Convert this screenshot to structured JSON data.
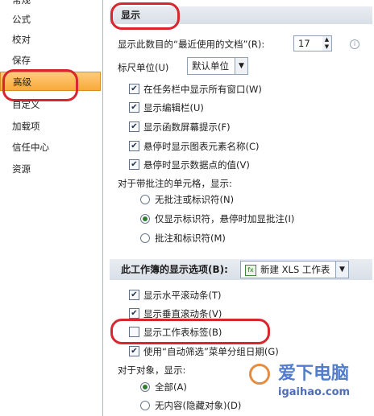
{
  "nav": {
    "items": [
      {
        "label": "常规"
      },
      {
        "label": "公式"
      },
      {
        "label": "校对"
      },
      {
        "label": "保存"
      },
      {
        "label": "高级"
      },
      {
        "label": "自定义"
      },
      {
        "label": "加载项"
      },
      {
        "label": "信任中心"
      },
      {
        "label": "资源"
      }
    ],
    "selected_index": 4
  },
  "display": {
    "header": "显示",
    "recent_docs_label": "显示此数目的“最近使用的文档”(R):",
    "recent_docs_value": "17",
    "ruler_label": "标尺单位(U)",
    "ruler_value": "默认单位",
    "checkboxes": [
      {
        "label": "在任务栏中显示所有窗口(W)",
        "checked": true
      },
      {
        "label": "显示编辑栏(U)",
        "checked": true
      },
      {
        "label": "显示函数屏幕提示(F)",
        "checked": true
      },
      {
        "label": "悬停时显示图表元素名称(C)",
        "checked": true
      },
      {
        "label": "悬停时显示数据点的值(V)",
        "checked": true
      }
    ],
    "comments_label": "对于带批注的单元格，显示:",
    "comment_options": [
      {
        "label": "无批注或标识符(N)",
        "selected": false
      },
      {
        "label": "仅显示标识符，悬停时加显批注(I)",
        "selected": true
      },
      {
        "label": "批注和标识符(M)",
        "selected": false
      }
    ]
  },
  "workbook": {
    "header": "此工作簿的显示选项(B):",
    "select_value": "新建 XLS 工作表",
    "icon": "excel-workbook-icon",
    "checkboxes": [
      {
        "label": "显示水平滚动条(T)",
        "checked": true
      },
      {
        "label": "显示垂直滚动条(V)",
        "checked": true
      },
      {
        "label": "显示工作表标签(B)",
        "checked": false
      },
      {
        "label": "使用“自动筛选”菜单分组日期(G)",
        "checked": true
      }
    ],
    "objects_label": "对于对象，显示:",
    "object_options": [
      {
        "label": "全部(A)",
        "selected": true
      },
      {
        "label": "无内容(隐藏对象)(D)",
        "selected": false
      }
    ]
  },
  "watermark": {
    "brand": "爱下电脑",
    "url": "igaihao.com"
  },
  "colors": {
    "annotation": "#d8262f",
    "selected_nav": "#f9a93a",
    "header_bg": "#d9dfe7"
  }
}
